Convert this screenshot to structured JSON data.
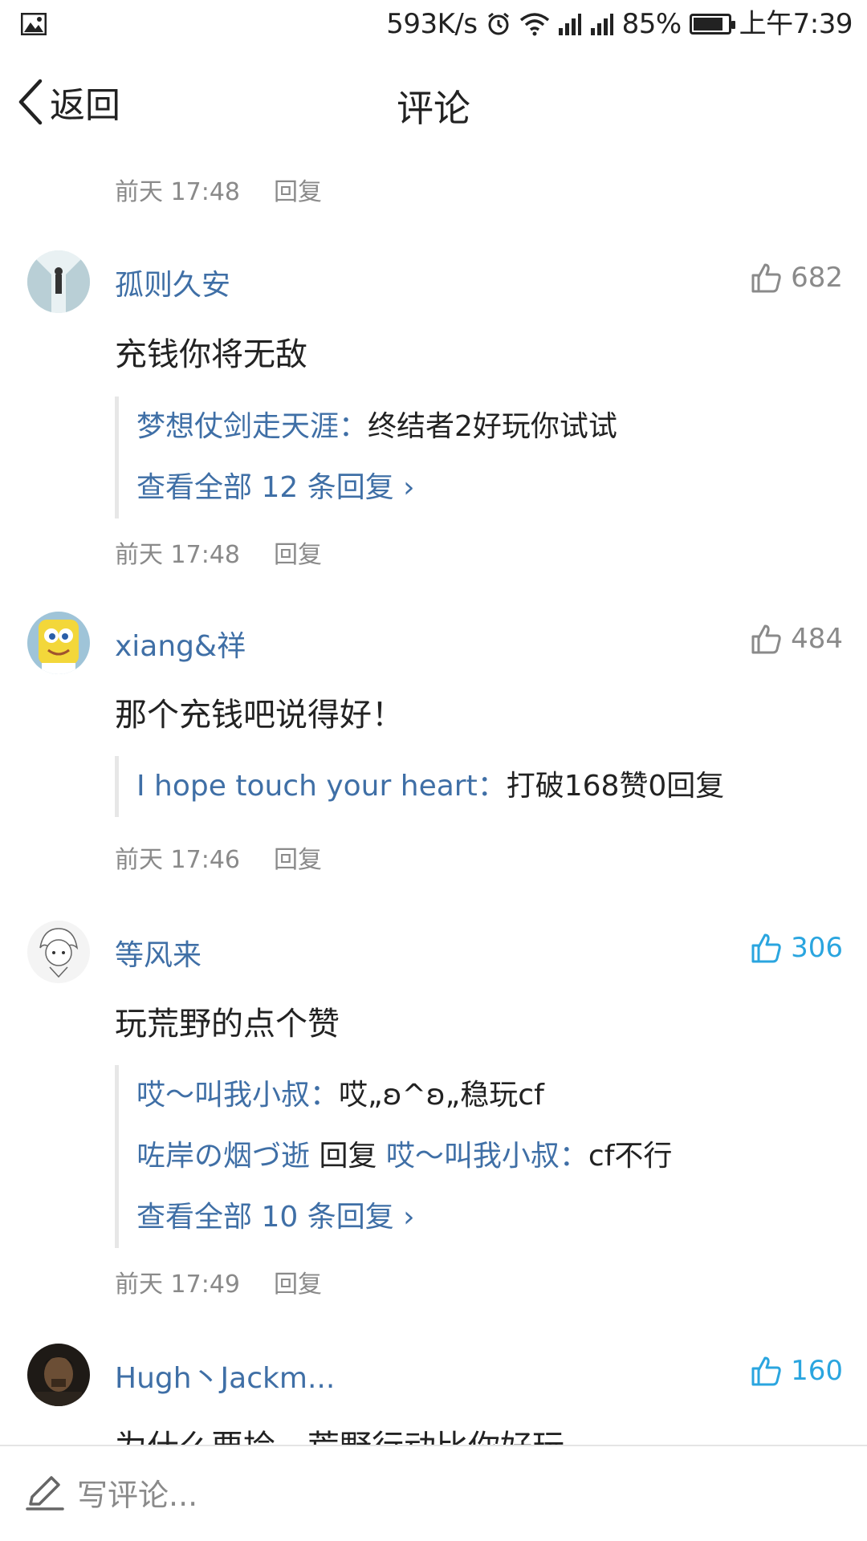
{
  "status_bar": {
    "speed": "593K/s",
    "battery": "85%",
    "time": "上午7:39"
  },
  "header": {
    "back_label": "返回",
    "title": "评论"
  },
  "top_meta": {
    "time": "前天 17:48",
    "reply": "回复"
  },
  "comments": [
    {
      "username": "孤则久安",
      "likes": "682",
      "liked": false,
      "content": "充钱你将无敌",
      "replies": [
        {
          "name": "梦想仗剑走天涯：",
          "text": "终结者2好玩你试试"
        }
      ],
      "view_all": "查看全部 12 条回复",
      "time": "前天 17:48",
      "reply": "回复"
    },
    {
      "username": "xiang&祥",
      "likes": "484",
      "liked": false,
      "content": "那个充钱吧说得好！",
      "replies": [
        {
          "name": "I hope touch your heart：",
          "text": "打破168赞0回复"
        }
      ],
      "time": "前天 17:46",
      "reply": "回复"
    },
    {
      "username": "等风来",
      "likes": "306",
      "liked": true,
      "content": "玩荒野的点个赞",
      "replies": [
        {
          "name": "哎～叫我小叔：",
          "text": "哎„ʚ^ʚ„稳玩cf"
        },
        {
          "name": "咗岸の烟づ逝",
          "mid": " 回复 ",
          "name2": "哎～叫我小叔：",
          "text": "cf不行"
        }
      ],
      "view_all": "查看全部 10 条回复",
      "time": "前天 17:49",
      "reply": "回复"
    },
    {
      "username": "Hugh丶Jackm...",
      "likes": "160",
      "liked": true,
      "content": "为什么要捡，荒野行动比你好玩"
    }
  ],
  "bottom_bar": {
    "placeholder": "写评论..."
  },
  "colors": {
    "link_blue": "#3f6fa6",
    "like_active": "#2aa5df",
    "meta_gray": "#8a8a8a"
  }
}
